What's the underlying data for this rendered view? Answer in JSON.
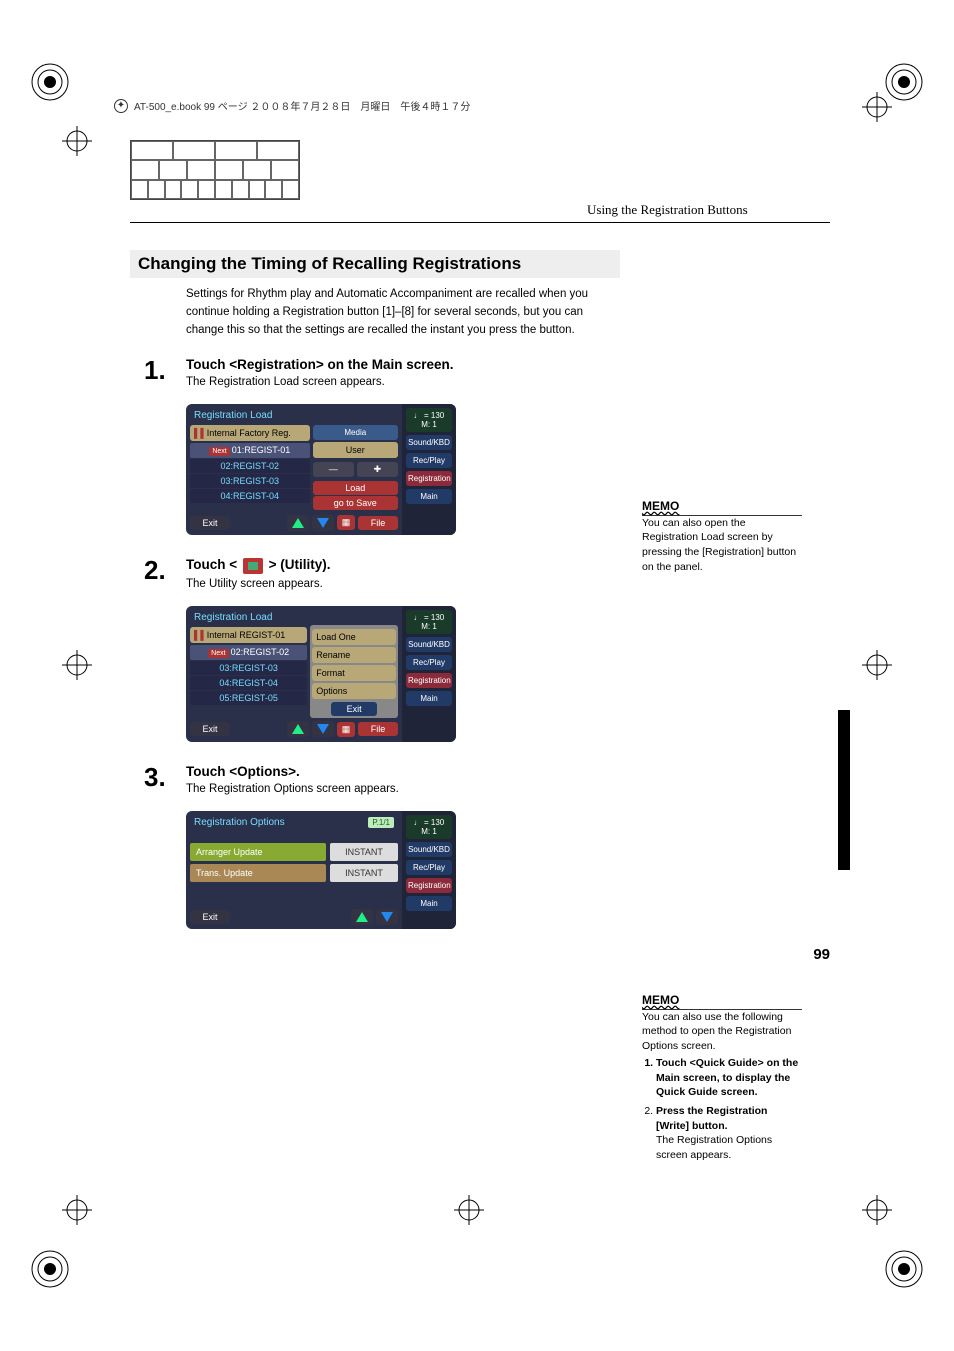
{
  "bookinfo": "AT-500_e.book  99 ページ  ２００８年７月２８日　月曜日　午後４時１７分",
  "header_section": "Using the Registration Buttons",
  "section_title": "Changing the Timing of Recalling Registrations",
  "intro": "Settings for Rhythm play and Automatic Accompaniment are recalled when you continue holding a Registration button [1]–[8] for several seconds, but you can change this so that the settings are recalled the instant you press the button.",
  "steps": {
    "s1": {
      "num": "1.",
      "heading": "Touch <Registration> on the Main screen.",
      "desc": "The Registration Load screen appears."
    },
    "s2": {
      "num": "2.",
      "heading_pre": "Touch < ",
      "heading_post": " > (Utility).",
      "desc": "The Utility screen appears."
    },
    "s3": {
      "num": "3.",
      "heading": "Touch <Options>.",
      "desc": "The Registration Options screen appears."
    }
  },
  "memo1": {
    "label": "MEMO",
    "text": "You can also open the Registration Load screen by pressing the [Registration] button on the panel."
  },
  "memo2": {
    "label": "MEMO",
    "intro": "You can also use the following method to open the Registration Options screen.",
    "li1": "Touch <Quick Guide> on the Main screen, to display the Quick Guide screen.",
    "li2": "Press the Registration [Write] button.",
    "sub": "The Registration Options screen appears."
  },
  "ss1": {
    "title": "Registration Load",
    "internal": "Internal  Factory Reg.",
    "media": "Media",
    "user": "User",
    "rows": [
      "01:REGIST-01",
      "02:REGIST-02",
      "03:REGIST-03",
      "04:REGIST-04"
    ],
    "next": "Next",
    "minus": "—",
    "plus": "✚",
    "load": "Load",
    "gosave": "go to Save",
    "exit": "Exit",
    "file": "File",
    "tempo": "♩ = 130",
    "meas": "M:     1",
    "side": [
      "Sound/KBD",
      "Rec/Play",
      "Registration",
      "Main"
    ]
  },
  "ss2": {
    "title": "Registration Load",
    "internal": "Internal  REGIST-01",
    "rows": [
      "02:REGIST-02",
      "03:REGIST-03",
      "04:REGIST-04",
      "05:REGIST-05"
    ],
    "next": "Next",
    "menu": [
      "Load One",
      "Rename",
      "Format",
      "Options",
      "Exit"
    ],
    "exit": "Exit",
    "file": "File",
    "tempo": "♩ = 130",
    "meas": "M:     1",
    "side": [
      "Sound/KBD",
      "Rec/Play",
      "Registration",
      "Main"
    ]
  },
  "ss3": {
    "title": "Registration Options",
    "page": "P.1/1",
    "rows": [
      {
        "label": "Arranger Update",
        "val": "INSTANT"
      },
      {
        "label": "Trans. Update",
        "val": "INSTANT"
      }
    ],
    "exit": "Exit",
    "tempo": "♩ = 130",
    "meas": "M:     1",
    "side": [
      "Sound/KBD",
      "Rec/Play",
      "Registration",
      "Main"
    ]
  },
  "sidetab": "Using the Registration Buttons",
  "pagenum": "99"
}
